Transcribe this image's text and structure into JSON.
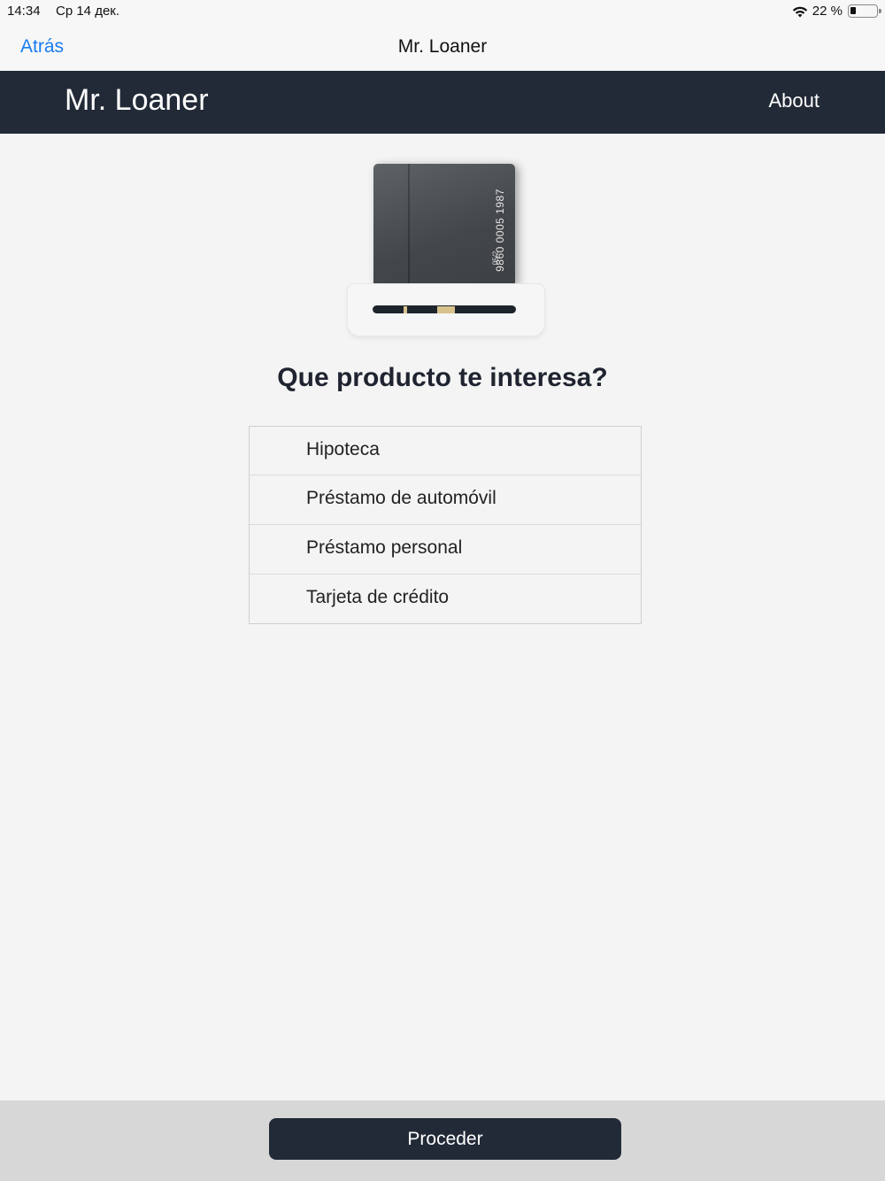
{
  "status_bar": {
    "time": "14:34",
    "date": "Ср 14 дек.",
    "battery": "22 %",
    "battery_level": 0.22
  },
  "nav_bar": {
    "back_label": "Atrás",
    "title": "Mr. Loaner"
  },
  "app_header": {
    "brand": "Mr. Loaner",
    "about_label": "About",
    "background_color": "#222a37"
  },
  "card_illustration": {
    "card_number": "9860 0005 1987",
    "expiry": "05/2"
  },
  "main": {
    "question": "Que producto te interesa?",
    "options": [
      {
        "label": "Hipoteca"
      },
      {
        "label": "Préstamo de automóvil"
      },
      {
        "label": "Préstamo personal"
      },
      {
        "label": "Tarjeta de crédito"
      }
    ]
  },
  "footer": {
    "proceed_label": "Proceder"
  },
  "colors": {
    "link": "#1a7cf0",
    "primary_dark": "#222a37",
    "page_background": "#f4f4f4"
  }
}
